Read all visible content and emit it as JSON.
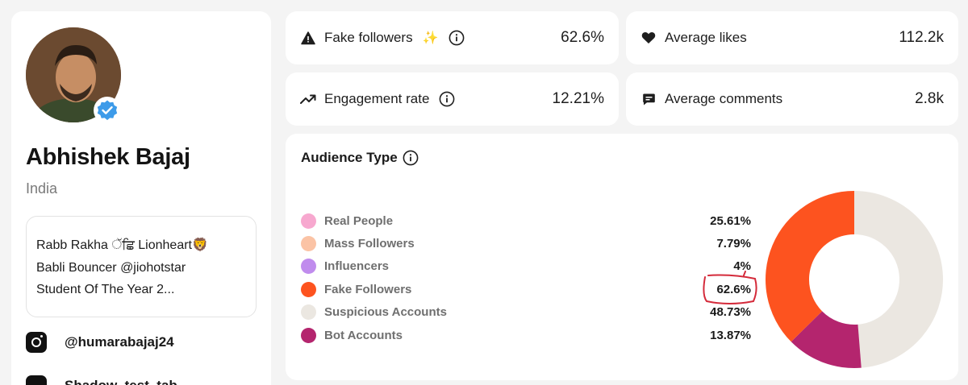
{
  "profile": {
    "name": "Abhishek Bajaj",
    "country": "India",
    "bio_lines": [
      "Rabb Rakha ੱਛਿ Lionheart🦁",
      "Babli Bouncer @jiohotstar",
      "Student Of The Year 2..."
    ],
    "instagram_handle": "@humarabajaj24",
    "secondary_handle": "Shadow_test_tab..."
  },
  "stats": {
    "fake_followers": {
      "label": "Fake followers",
      "value": "62.6%",
      "icon": "warning-icon"
    },
    "average_likes": {
      "label": "Average likes",
      "value": "112.2k",
      "icon": "heart-icon"
    },
    "engagement_rate": {
      "label": "Engagement rate",
      "value": "12.21%",
      "icon": "trending-up-icon"
    },
    "average_comments": {
      "label": "Average comments",
      "value": "2.8k",
      "icon": "comment-icon"
    }
  },
  "audience": {
    "title": "Audience Type",
    "items": [
      {
        "label": "Real People",
        "value": "25.61%",
        "color": "#f7a8cf"
      },
      {
        "label": "Mass Followers",
        "value": "7.79%",
        "color": "#fbc3a5"
      },
      {
        "label": "Influencers",
        "value": "4%",
        "color": "#c08ced"
      },
      {
        "label": "Fake Followers",
        "value": "62.6%",
        "color": "#fd531f"
      },
      {
        "label": "Suspicious Accounts",
        "value": "48.73%",
        "color": "#ebe7e1"
      },
      {
        "label": "Bot Accounts",
        "value": "13.87%",
        "color": "#b4256e"
      }
    ],
    "donut": {
      "segments": [
        {
          "label": "Suspicious Accounts",
          "percent": 48.73,
          "color": "#ebe7e1"
        },
        {
          "label": "Bot Accounts",
          "percent": 13.87,
          "color": "#b4256e"
        },
        {
          "label": "Fake Followers",
          "percent": 37.4,
          "color": "#fd531f"
        }
      ]
    }
  },
  "colors": {
    "accent_orange": "#fd531f",
    "verified_blue": "#3d9be9",
    "annotation_red": "#d42a3a"
  }
}
